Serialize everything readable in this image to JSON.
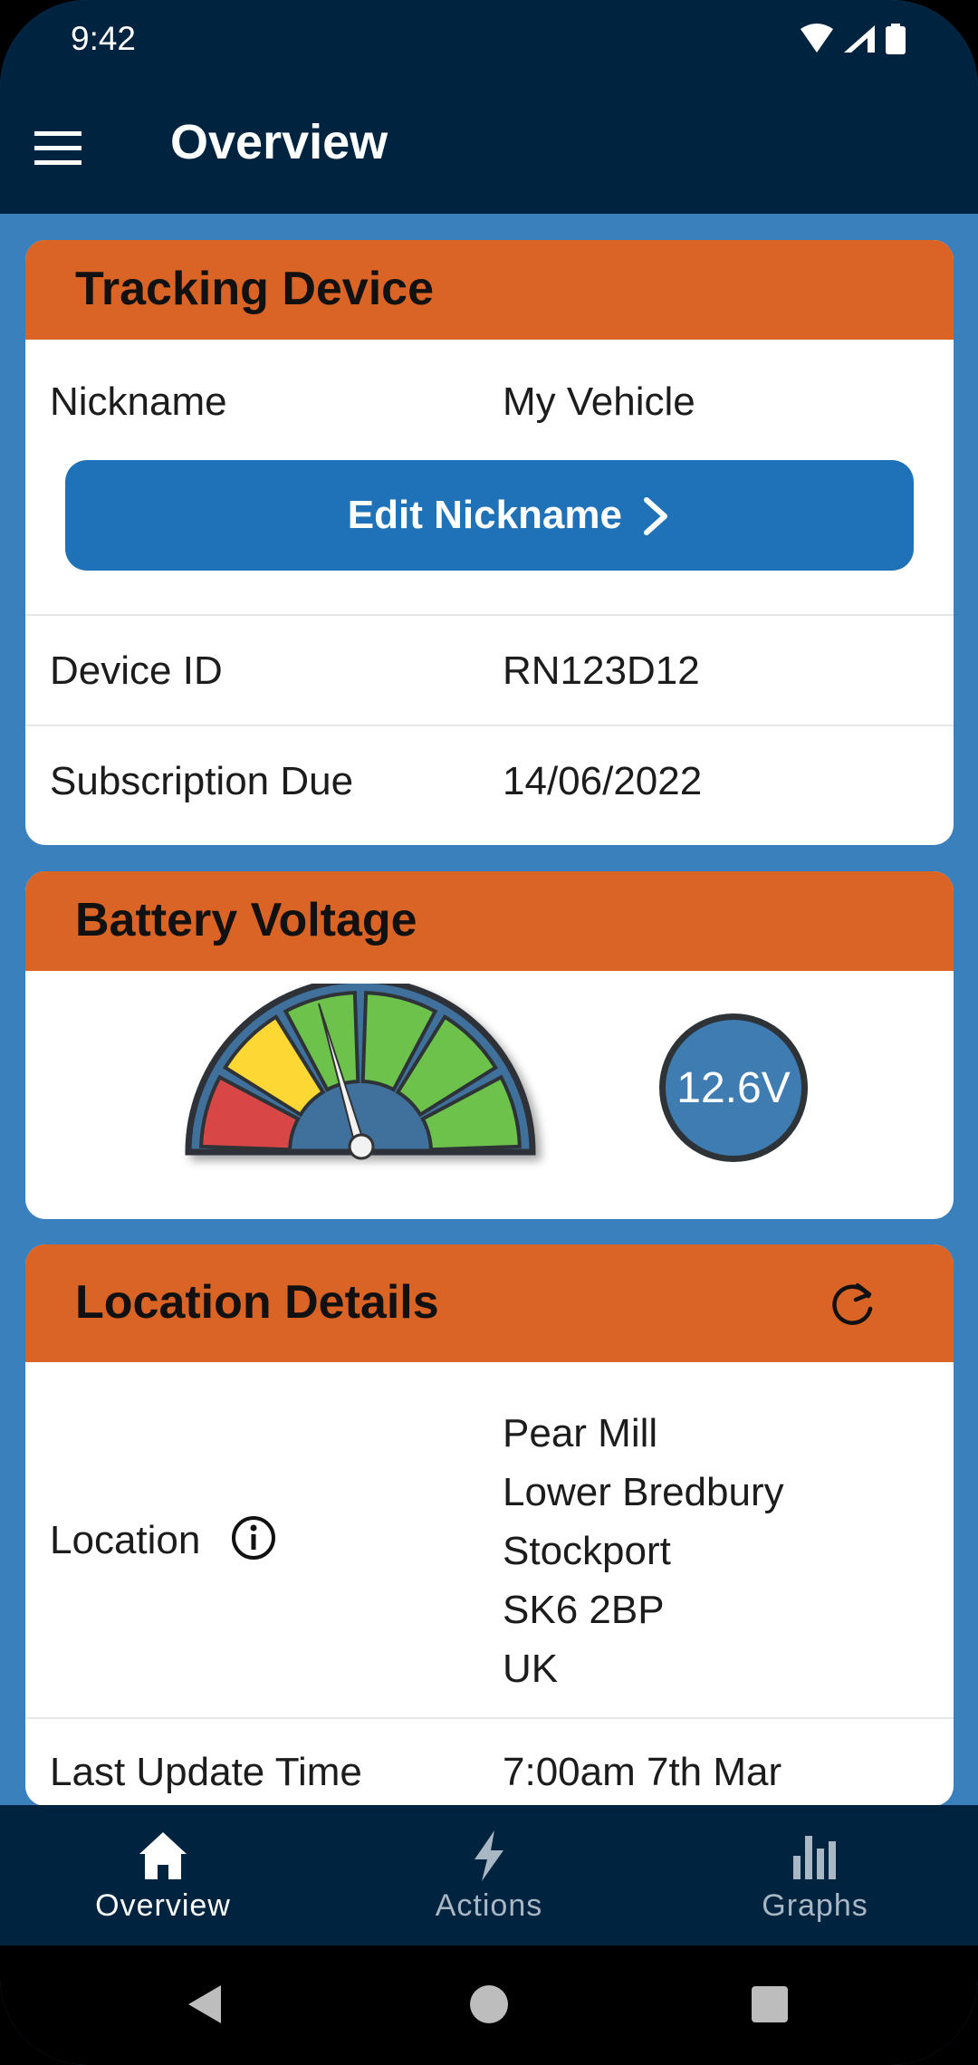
{
  "status_bar": {
    "time": "9:42"
  },
  "app_bar": {
    "title": "Overview",
    "menu_icon": "hamburger-menu-icon"
  },
  "tracking_device": {
    "title": "Tracking Device",
    "nickname_label": "Nickname",
    "nickname_value": "My Vehicle",
    "edit_button_label": "Edit Nickname",
    "device_id_label": "Device ID",
    "device_id_value": "RN123D12",
    "subscription_label": "Subscription Due",
    "subscription_value": "14/06/2022"
  },
  "battery": {
    "title": "Battery Voltage",
    "voltage_text": "12.6V",
    "gauge_segments": [
      {
        "color": "#d94646"
      },
      {
        "color": "#fdd835"
      },
      {
        "color": "#6cc24a"
      },
      {
        "color": "#6cc24a"
      },
      {
        "color": "#6cc24a"
      },
      {
        "color": "#6cc24a"
      }
    ]
  },
  "location": {
    "title": "Location Details",
    "refresh_icon": "refresh-icon",
    "location_label": "Location",
    "address_lines": [
      "Pear Mill",
      "Lower Bredbury",
      "Stockport",
      "SK6 2BP",
      "UK"
    ],
    "last_update_label": "Last Update Time",
    "last_update_value": "7:00am 7th Mar"
  },
  "bottom_nav": [
    {
      "label": "Overview",
      "icon": "home-icon",
      "active": true
    },
    {
      "label": "Actions",
      "icon": "lightning-icon",
      "active": false
    },
    {
      "label": "Graphs",
      "icon": "bar-chart-icon",
      "active": false
    }
  ],
  "colors": {
    "primary_dark": "#00243f",
    "background_blue": "#3a80bd",
    "header_orange": "#d96426",
    "button_blue": "#1f72b8"
  }
}
